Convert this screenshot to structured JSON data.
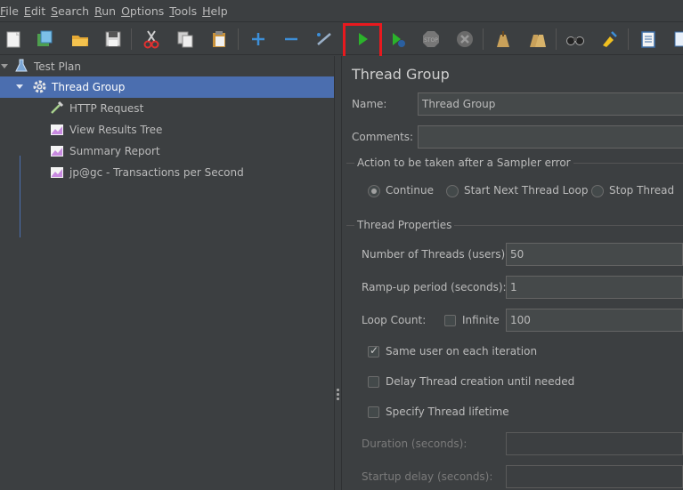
{
  "menu": [
    {
      "mn": "F",
      "rest": "ile"
    },
    {
      "mn": "E",
      "rest": "dit"
    },
    {
      "mn": "S",
      "rest": "earch"
    },
    {
      "mn": "R",
      "rest": "un"
    },
    {
      "mn": "O",
      "rest": "ptions"
    },
    {
      "mn": "T",
      "rest": "ools"
    },
    {
      "mn": "H",
      "rest": "elp"
    }
  ],
  "toolbar": {
    "icons": [
      "new-icon",
      "templates-icon",
      "open-icon",
      "save-icon",
      "cut-icon",
      "copy-icon",
      "paste-icon",
      "expand-icon",
      "collapse-icon",
      "toggle-icon",
      "start-icon",
      "start-no-pauses-icon",
      "stop-icon",
      "shutdown-icon",
      "clear-icon",
      "clear-all-icon",
      "search-icon",
      "reset-search-icon",
      "function-helper-icon",
      "help-icon"
    ]
  },
  "tree": {
    "items": [
      {
        "label": "Test Plan",
        "icon": "test-plan-icon"
      },
      {
        "label": "Thread Group",
        "icon": "thread-group-gear-icon"
      },
      {
        "label": "HTTP Request",
        "icon": "sampler-pipette-icon"
      },
      {
        "label": "View Results Tree",
        "icon": "listener-chart-icon"
      },
      {
        "label": "Summary Report",
        "icon": "listener-chart-icon"
      },
      {
        "label": "jp@gc - Transactions per Second",
        "icon": "listener-chart-icon"
      }
    ]
  },
  "panel": {
    "title": "Thread Group",
    "name_label": "Name:",
    "name_value": "Thread Group",
    "comments_label": "Comments:",
    "comments_value": "",
    "error_group_title": "Action to be taken after a Sampler error",
    "error_options": [
      "Continue",
      "Start Next Thread Loop",
      "Stop Thread"
    ],
    "error_selected": "Continue",
    "props_group_title": "Thread Properties",
    "threads_label": "Number of Threads (users):",
    "threads_value": "50",
    "rampup_label": "Ramp-up period (seconds):",
    "rampup_value": "1",
    "loop_label": "Loop Count:",
    "infinite_label": "Infinite",
    "infinite_checked": false,
    "loop_value": "100",
    "same_user_label": "Same user on each iteration",
    "same_user_checked": true,
    "delay_label": "Delay Thread creation until needed",
    "delay_checked": false,
    "lifetime_label": "Specify Thread lifetime",
    "lifetime_checked": false,
    "duration_label": "Duration (seconds):",
    "duration_value": "",
    "startup_label": "Startup delay (seconds):",
    "startup_value": ""
  }
}
